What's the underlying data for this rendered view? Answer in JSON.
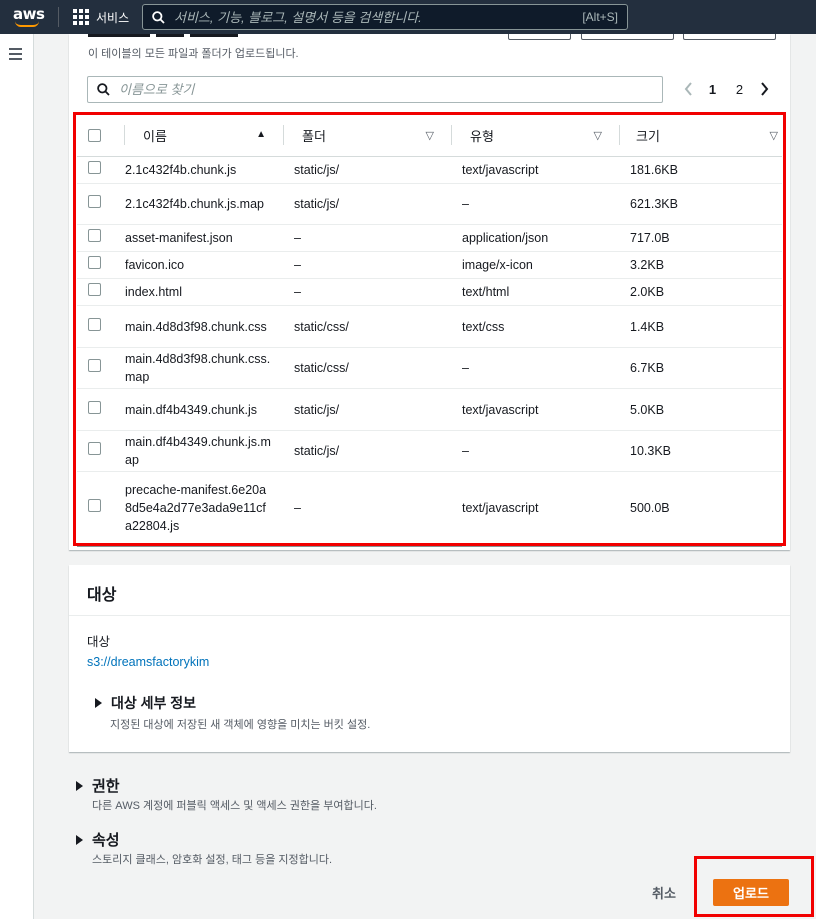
{
  "nav": {
    "logo": "aws",
    "services_label": "서비스",
    "search_placeholder": "서비스, 기능, 블로그, 설명서 등을 검색합니다.",
    "search_hint": "[Alt+S]"
  },
  "files": {
    "description": "이 테이블의 모든 파일과 폴더가 업로드됩니다.",
    "filter_placeholder": "이름으로 찾기",
    "pagination": {
      "pages": [
        "1",
        "2"
      ],
      "current": "1"
    },
    "columns": {
      "name": "이름",
      "folder": "폴더",
      "type": "유형",
      "size": "크기"
    },
    "rows": [
      {
        "name": "2.1c432f4b.chunk.js",
        "folder": "static/js/",
        "type": "text/javascript",
        "size": "181.6KB"
      },
      {
        "name": "2.1c432f4b.chunk.js.map",
        "folder": "static/js/",
        "type": "–",
        "size": "621.3KB"
      },
      {
        "name": "asset-manifest.json",
        "folder": "–",
        "type": "application/json",
        "size": "717.0B"
      },
      {
        "name": "favicon.ico",
        "folder": "–",
        "type": "image/x-icon",
        "size": "3.2KB"
      },
      {
        "name": "index.html",
        "folder": "–",
        "type": "text/html",
        "size": "2.0KB"
      },
      {
        "name": "main.4d8d3f98.chunk.css",
        "folder": "static/css/",
        "type": "text/css",
        "size": "1.4KB"
      },
      {
        "name": "main.4d8d3f98.chunk.css.map",
        "folder": "static/css/",
        "type": "–",
        "size": "6.7KB"
      },
      {
        "name": "main.df4b4349.chunk.js",
        "folder": "static/js/",
        "type": "text/javascript",
        "size": "5.0KB"
      },
      {
        "name": "main.df4b4349.chunk.js.map",
        "folder": "static/js/",
        "type": "–",
        "size": "10.3KB"
      },
      {
        "name": "precache-manifest.6e20a8d5e4a2d77e3ada9e11cfa22804.js",
        "folder": "–",
        "type": "text/javascript",
        "size": "500.0B"
      }
    ]
  },
  "destination": {
    "title": "대상",
    "label": "대상",
    "bucket": "s3://dreamsfactorykim",
    "details_label": "대상 세부 정보",
    "details_desc": "지정된 대상에 저장된 새 객체에 영향을 미치는 버킷 설정."
  },
  "permissions": {
    "label": "권한",
    "desc": "다른 AWS 계정에 퍼블릭 액세스 및 액세스 권한을 부여합니다."
  },
  "properties": {
    "label": "속성",
    "desc": "스토리지 클래스, 암호화 설정, 태그 등을 지정합니다."
  },
  "actions": {
    "cancel": "취소",
    "upload": "업로드"
  },
  "colors": {
    "nav_bg": "#232f3e",
    "primary": "#ec7211",
    "link": "#0073bb",
    "highlight": "#f10000"
  }
}
